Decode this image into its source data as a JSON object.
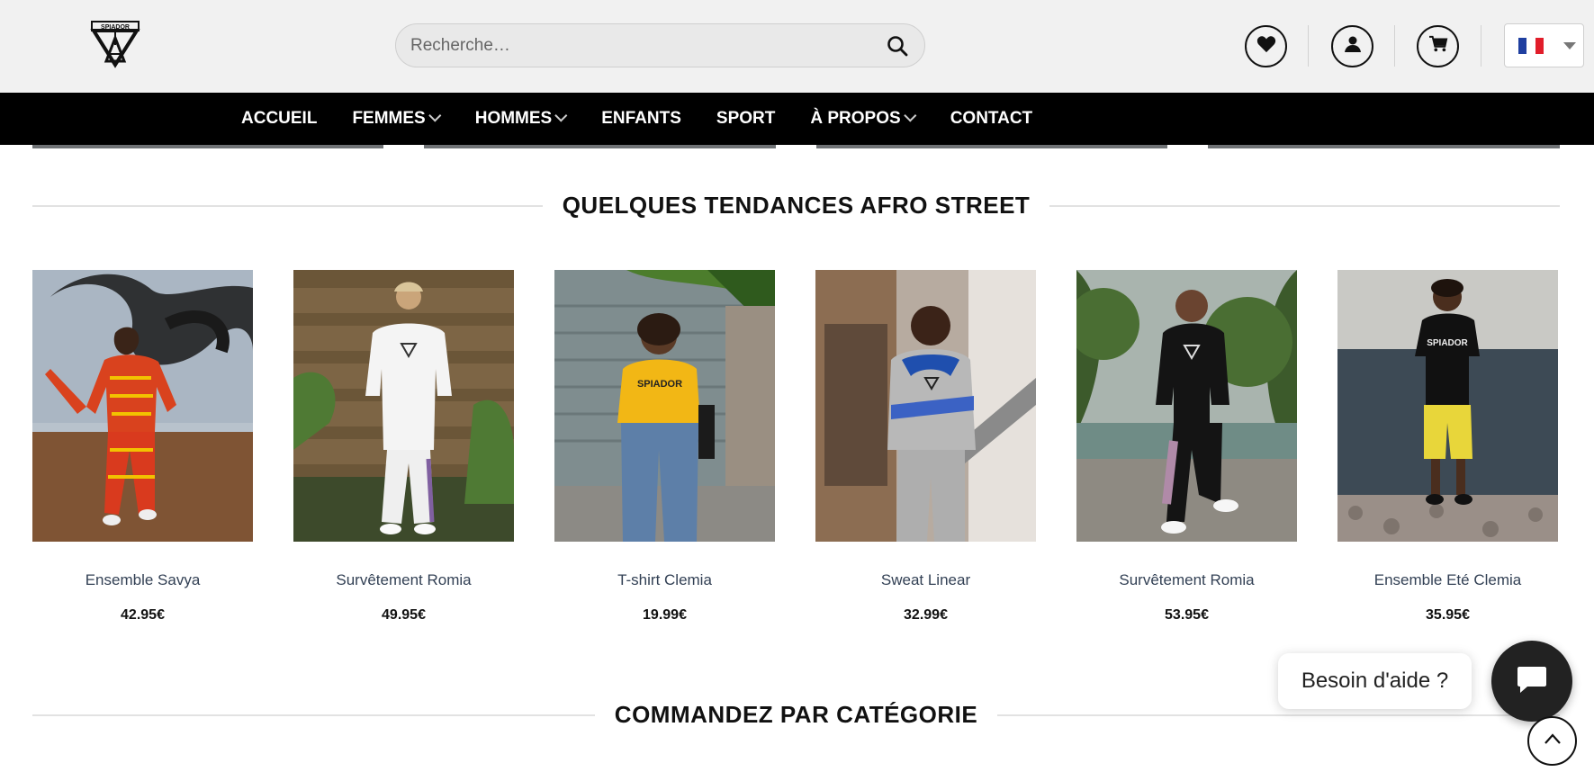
{
  "header": {
    "logo_label": "SPIADOR",
    "search": {
      "placeholder": "Recherche…",
      "value": ""
    },
    "icons": [
      "search-icon",
      "heart-icon",
      "user-icon",
      "cart-icon",
      "flag-fr-icon"
    ],
    "language": "fr"
  },
  "nav": {
    "items": [
      {
        "label": "ACCUEIL",
        "dropdown": false
      },
      {
        "label": "FEMMES",
        "dropdown": true
      },
      {
        "label": "HOMMES",
        "dropdown": true
      },
      {
        "label": "ENFANTS",
        "dropdown": false
      },
      {
        "label": "SPORT",
        "dropdown": false
      },
      {
        "label": "À PROPOS",
        "dropdown": true
      },
      {
        "label": "CONTACT",
        "dropdown": false
      }
    ]
  },
  "sections": {
    "trends_title": "QUELQUES TENDANCES AFRO STREET",
    "categories_title": "COMMANDEZ PAR CATÉGORIE"
  },
  "products": [
    {
      "name": "Ensemble Savya",
      "price": "42.95€"
    },
    {
      "name": "Survêtement Romia",
      "price": "49.95€"
    },
    {
      "name": "T-shirt Clemia",
      "price": "19.99€"
    },
    {
      "name": "Sweat Linear",
      "price": "32.99€"
    },
    {
      "name": "Survêtement Romia",
      "price": "53.95€"
    },
    {
      "name": "Ensemble Eté Clemia",
      "price": "35.95€"
    }
  ],
  "help": {
    "bubble_text": "Besoin d'aide ?"
  },
  "colors": {
    "nav_bg": "#000000",
    "header_bg": "#f1f1f1",
    "product_name": "#334155"
  }
}
